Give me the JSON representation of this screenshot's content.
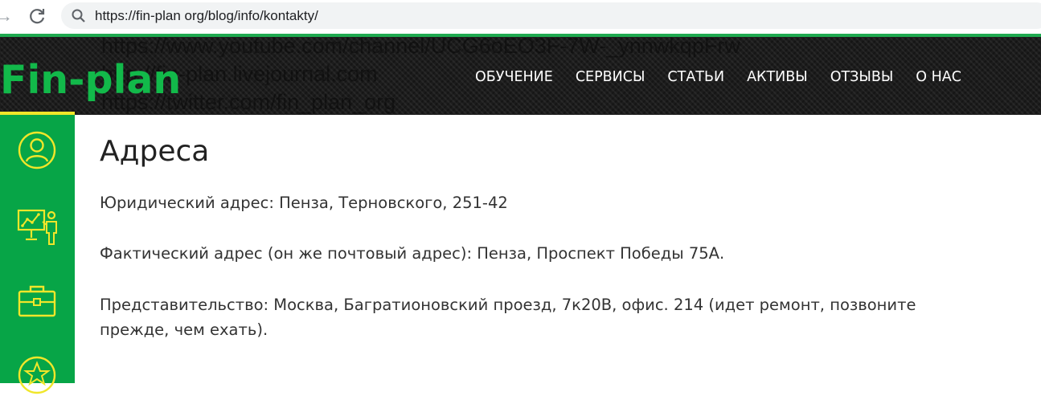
{
  "browser": {
    "url": "https://fin-plan org/blog/info/kontakty/"
  },
  "header": {
    "ghost_links": [
      "https://www.youtube.com/channel/UCG6oEO3F-7W-_ynnwkqpFrw",
      "http://fin-plan.livejournal.com",
      "https://twitter.com/fin_plan_org"
    ],
    "logo": "Fin-plan",
    "nav": [
      "ОБУЧЕНИЕ",
      "СЕРВИСЫ",
      "СТАТЬИ",
      "АКТИВЫ",
      "ОТЗЫВЫ",
      "О НАС"
    ]
  },
  "sidebar": {
    "icons": [
      "user-circle-icon",
      "presentation-icon",
      "briefcase-icon",
      "star-circle-icon"
    ]
  },
  "colors": {
    "brand_green": "#12b94a",
    "sidebar_green": "#07a547",
    "accent_yellow": "#f0e62a",
    "header_dark": "#1c1c1c"
  },
  "content": {
    "title": "Адреса",
    "legal_address": "Юридический адрес: Пенза, Терновского, 251-42",
    "actual_address": "Фактический адрес (он же почтовый адрес): Пенза, Проспект Победы 75А.",
    "representative_line1": "Представительство: Москва, Багратионовский проезд, 7к20В, офис. 214 (идет ремонт, позвоните",
    "representative_line2": "прежде, чем ехать)."
  }
}
